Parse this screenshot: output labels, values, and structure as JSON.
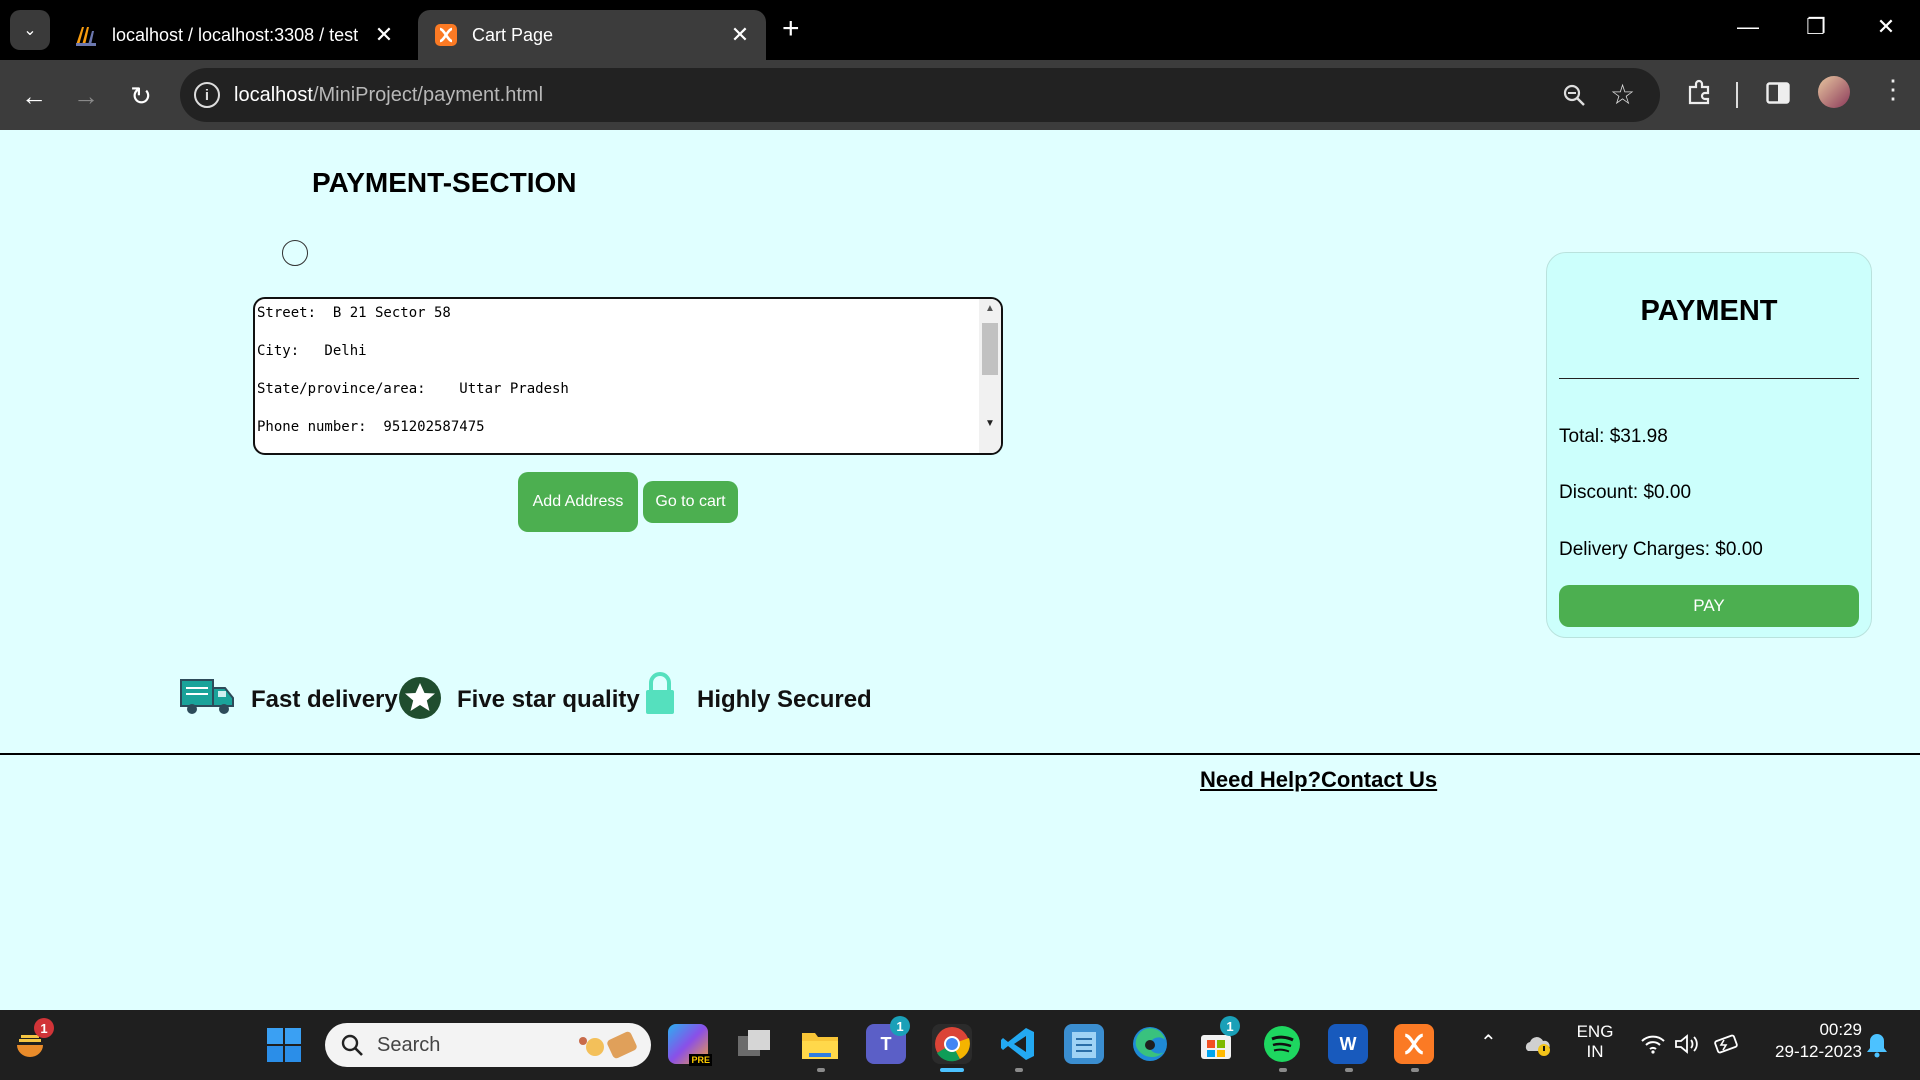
{
  "browser": {
    "tabs": [
      {
        "title": "localhost / localhost:3308 / test",
        "active": false,
        "favicon": "phpmyadmin-icon"
      },
      {
        "title": "Cart Page",
        "active": true,
        "favicon": "xampp-icon"
      }
    ],
    "url_host": "localhost",
    "url_path": "/MiniProject/payment.html"
  },
  "page": {
    "heading": "PAYMENT-SECTION",
    "address_lines": [
      "Street:  B 21 Sector 58",
      "City:   Delhi",
      "State/province/area:    Uttar Pradesh",
      "Phone number:  951202587475"
    ],
    "add_address_label": "Add Address",
    "go_to_cart_label": "Go to cart",
    "payment_card": {
      "title": "PAYMENT",
      "total": "Total: $31.98",
      "discount": "Discount: $0.00",
      "delivery": "Delivery Charges: $0.00",
      "pay_label": "PAY"
    },
    "features": {
      "fast_delivery": "Fast delivery",
      "five_star": "Five star quality",
      "secured": "Highly Secured"
    },
    "help_link": "Need Help?Contact Us",
    "colors": {
      "background": "#e0ffff",
      "button_green": "#4caf50",
      "card_bg": "#ccfffc"
    }
  },
  "taskbar": {
    "search_placeholder": "Search",
    "lang_line1": "ENG",
    "lang_line2": "IN",
    "time": "00:29",
    "date": "29-12-2023",
    "badges": {
      "widgets": "1",
      "teams": "1",
      "store": "1"
    }
  }
}
